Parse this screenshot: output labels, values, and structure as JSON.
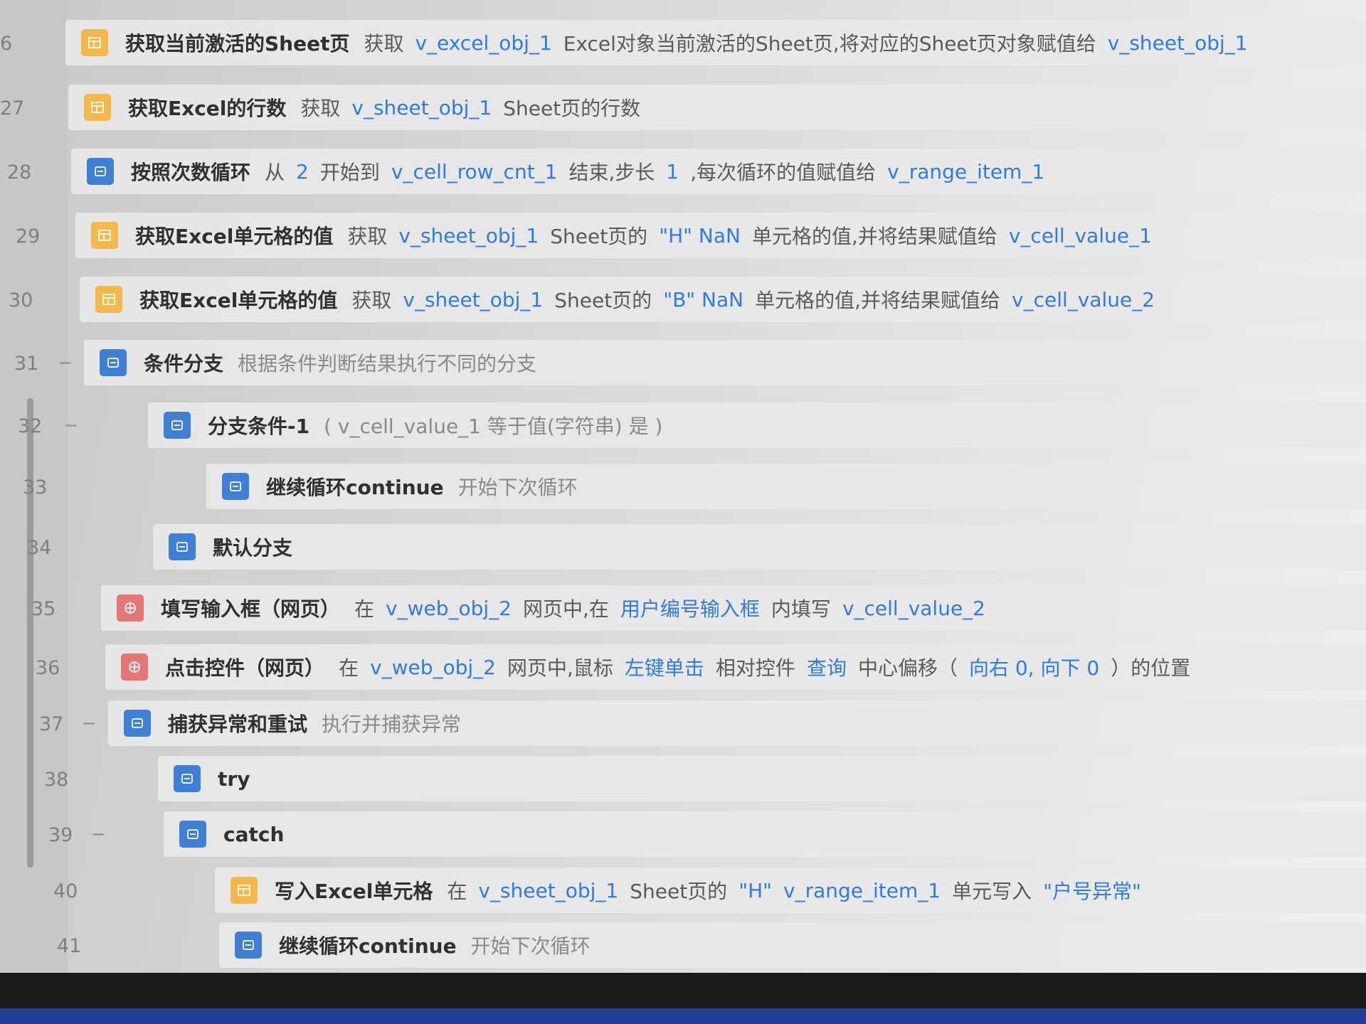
{
  "rows": [
    {
      "line": "6",
      "icon": "excel",
      "icon_name": "excel-sheet-icon",
      "title": "获取当前激活的Sheet页",
      "segments": [
        {
          "kind": "t",
          "text": "获取"
        },
        {
          "kind": "v",
          "text": "v_excel_obj_1"
        },
        {
          "kind": "t",
          "text": "Excel对象当前激活的Sheet页,将对应的Sheet页对象赋值给"
        },
        {
          "kind": "v",
          "text": "v_sheet_obj_1"
        }
      ]
    },
    {
      "line": "27",
      "icon": "excel",
      "icon_name": "excel-sheet-icon",
      "title": "获取Excel的行数",
      "segments": [
        {
          "kind": "t",
          "text": "获取"
        },
        {
          "kind": "v",
          "text": "v_sheet_obj_1"
        },
        {
          "kind": "t",
          "text": "Sheet页的行数"
        }
      ]
    },
    {
      "line": "28",
      "icon": "flow",
      "icon_name": "loop-icon",
      "title": "按照次数循环",
      "segments": [
        {
          "kind": "t",
          "text": "从"
        },
        {
          "kind": "v",
          "text": "2"
        },
        {
          "kind": "t",
          "text": "开始到"
        },
        {
          "kind": "v",
          "text": "v_cell_row_cnt_1"
        },
        {
          "kind": "t",
          "text": "结束,步长"
        },
        {
          "kind": "v",
          "text": "1"
        },
        {
          "kind": "t",
          "text": ",每次循环的值赋值给"
        },
        {
          "kind": "v",
          "text": "v_range_item_1"
        }
      ]
    },
    {
      "line": "29",
      "icon": "excel",
      "icon_name": "excel-sheet-icon",
      "title": "获取Excel单元格的值",
      "segments": [
        {
          "kind": "t",
          "text": "获取"
        },
        {
          "kind": "v",
          "text": "v_sheet_obj_1"
        },
        {
          "kind": "t",
          "text": "Sheet页的"
        },
        {
          "kind": "s",
          "text": "\"H\" NaN"
        },
        {
          "kind": "t",
          "text": "单元格的值,并将结果赋值给"
        },
        {
          "kind": "v",
          "text": "v_cell_value_1"
        }
      ]
    },
    {
      "line": "30",
      "icon": "excel",
      "icon_name": "excel-sheet-icon",
      "title": "获取Excel单元格的值",
      "segments": [
        {
          "kind": "t",
          "text": "获取"
        },
        {
          "kind": "v",
          "text": "v_sheet_obj_1"
        },
        {
          "kind": "t",
          "text": "Sheet页的"
        },
        {
          "kind": "s",
          "text": "\"B\" NaN"
        },
        {
          "kind": "t",
          "text": "单元格的值,并将结果赋值给"
        },
        {
          "kind": "v",
          "text": "v_cell_value_2"
        }
      ]
    },
    {
      "line": "31",
      "fold": "−",
      "icon": "flow",
      "icon_name": "branch-icon",
      "title": "条件分支",
      "segments": [
        {
          "kind": "g",
          "text": "根据条件判断结果执行不同的分支"
        }
      ]
    },
    {
      "line": "32",
      "fold": "−",
      "icon": "flow",
      "icon_name": "branch-icon",
      "title": "分支条件-1",
      "segments": [
        {
          "kind": "g",
          "text": "( v_cell_value_1 等于值(字符串) 是 )"
        }
      ]
    },
    {
      "line": "33",
      "icon": "flow",
      "icon_name": "continue-icon",
      "title": "继续循环continue",
      "segments": [
        {
          "kind": "g",
          "text": "开始下次循环"
        }
      ]
    },
    {
      "line": "34",
      "icon": "flow",
      "icon_name": "branch-icon",
      "title": "默认分支",
      "segments": []
    },
    {
      "line": "35",
      "icon": "web",
      "icon_name": "web-globe-icon",
      "title": "填写输入框（网页）",
      "segments": [
        {
          "kind": "t",
          "text": "在"
        },
        {
          "kind": "v",
          "text": "v_web_obj_2"
        },
        {
          "kind": "t",
          "text": "网页中,在"
        },
        {
          "kind": "v",
          "text": "用户编号输入框"
        },
        {
          "kind": "t",
          "text": "内填写"
        },
        {
          "kind": "v",
          "text": "v_cell_value_2"
        }
      ]
    },
    {
      "line": "36",
      "icon": "web",
      "icon_name": "web-globe-icon",
      "title": "点击控件（网页）",
      "segments": [
        {
          "kind": "t",
          "text": "在"
        },
        {
          "kind": "v",
          "text": "v_web_obj_2"
        },
        {
          "kind": "t",
          "text": "网页中,鼠标"
        },
        {
          "kind": "v",
          "text": "左键单击"
        },
        {
          "kind": "t",
          "text": "相对控件"
        },
        {
          "kind": "v",
          "text": "查询"
        },
        {
          "kind": "t",
          "text": "中心偏移（"
        },
        {
          "kind": "v",
          "text": "向右 0, 向下 0"
        },
        {
          "kind": "t",
          "text": "）的位置"
        }
      ]
    },
    {
      "line": "37",
      "fold": "−",
      "icon": "flow",
      "icon_name": "try-catch-icon",
      "title": "捕获异常和重试",
      "segments": [
        {
          "kind": "g",
          "text": "执行并捕获异常"
        }
      ]
    },
    {
      "line": "38",
      "icon": "flow",
      "icon_name": "try-icon",
      "title": "try",
      "segments": []
    },
    {
      "line": "39",
      "fold": "−",
      "icon": "flow",
      "icon_name": "catch-icon",
      "title": "catch",
      "segments": []
    },
    {
      "line": "40",
      "icon": "excel",
      "icon_name": "excel-sheet-icon",
      "title": "写入Excel单元格",
      "segments": [
        {
          "kind": "t",
          "text": "在"
        },
        {
          "kind": "v",
          "text": "v_sheet_obj_1"
        },
        {
          "kind": "t",
          "text": "Sheet页的"
        },
        {
          "kind": "s",
          "text": "\"H\""
        },
        {
          "kind": "v",
          "text": "v_range_item_1"
        },
        {
          "kind": "t",
          "text": "单元写入"
        },
        {
          "kind": "s",
          "text": "\"户号异常\""
        }
      ]
    },
    {
      "line": "41",
      "icon": "flow",
      "icon_name": "continue-icon",
      "title": "继续循环continue",
      "segments": [
        {
          "kind": "g",
          "text": "开始下次循环"
        }
      ]
    }
  ]
}
